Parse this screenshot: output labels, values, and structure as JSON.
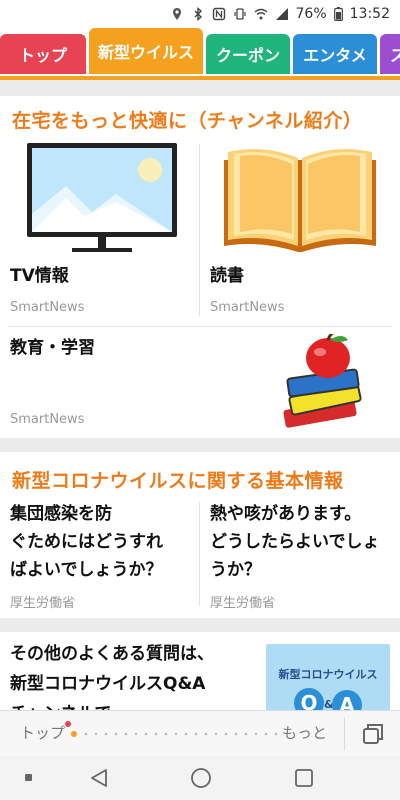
{
  "status_bar": {
    "battery": "76%",
    "time": "13:52"
  },
  "tabs": [
    {
      "label": "トップ",
      "color": "#e84352"
    },
    {
      "label": "新型ウイルス",
      "color": "#f5a01e"
    },
    {
      "label": "クーポン",
      "color": "#1fb57d"
    },
    {
      "label": "エンタメ",
      "color": "#2a8fd6"
    },
    {
      "label": "ス",
      "color": "#9b4fd0"
    }
  ],
  "section1": {
    "title": "在宅をもっと快適に（チャンネル紹介）",
    "items": [
      {
        "title": "TV情報",
        "source": "SmartNews",
        "icon": "tv-icon"
      },
      {
        "title": "読書",
        "source": "SmartNews",
        "icon": "book-icon"
      },
      {
        "title": "教育・学習",
        "source": "SmartNews",
        "icon": "apple-books-icon"
      }
    ]
  },
  "section2": {
    "title": "新型コロナウイルスに関する基本情報",
    "items": [
      {
        "lines": [
          "集団感染を防",
          "ぐためにはどうすれ",
          "ばよいでしょうか？"
        ],
        "source": "厚生労働省"
      },
      {
        "lines": [
          "熱や咳があります。",
          "どうしたらよいでしょ",
          "うか？"
        ],
        "source": "厚生労働省"
      }
    ]
  },
  "section3": {
    "lines": [
      "その他のよくある質問は、",
      "新型コロナウイルスQ&A",
      "チャンネルで"
    ],
    "thumb_label": "新型コロナウイルス",
    "thumb_badge": "Q",
    "thumb_badge_small": "&",
    "thumb_badge2": "A"
  },
  "bottom_bar": {
    "left": "トップ",
    "right": "もっと"
  }
}
